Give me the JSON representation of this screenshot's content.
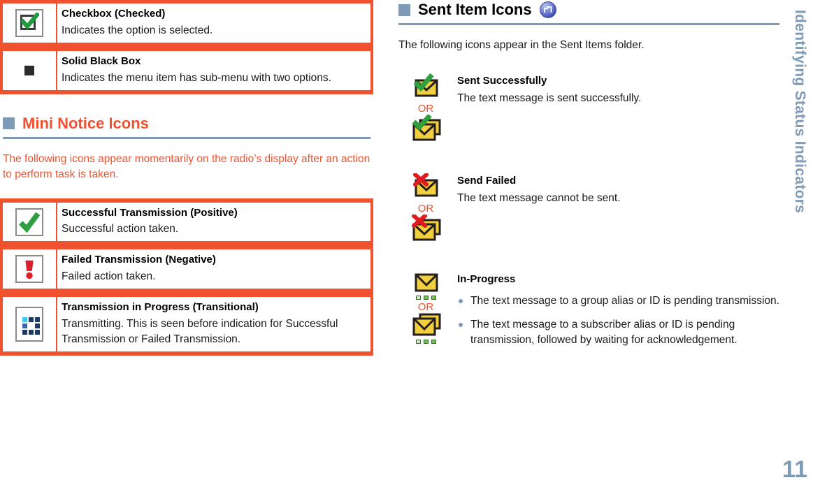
{
  "sidebar": {
    "chapter_label": "Identifying Status Indicators",
    "page_number": "11"
  },
  "colors": {
    "orange": "#f0522f",
    "blue_gray": "#7f9ab5",
    "heading_black": "#000000"
  },
  "left_column": {
    "top_table": {
      "rows": [
        {
          "icon": "checkbox-checked-icon",
          "title": "Checkbox (Checked)",
          "description": "Indicates the option is selected."
        },
        {
          "icon": "solid-black-box-icon",
          "title": "Solid Black Box",
          "description": "Indicates the menu item has sub-menu with two options."
        }
      ]
    },
    "section": {
      "bullet": "section-bullet-square",
      "title": "Mini Notice Icons",
      "lead": "The following icons appear momentarily on the radio’s display after an action to perform task is taken."
    },
    "bottom_table": {
      "rows": [
        {
          "icon": "green-check-icon",
          "title": "Successful Transmission (Positive)",
          "description": "Successful action taken."
        },
        {
          "icon": "red-exclamation-icon",
          "title": "Failed Transmission (Negative)",
          "description": "Failed action taken."
        },
        {
          "icon": "transmitting-grid-icon",
          "title": "Transmission in Progress (Transitional)",
          "description": "Transmitting. This is seen before indication for Successful Transmission or Failed Transmission."
        }
      ]
    }
  },
  "right_column": {
    "section": {
      "bullet": "section-bullet-square",
      "title": "Sent Item Icons",
      "badge": "step-wave-badge-icon",
      "lead": "The following icons appear in the Sent Items folder."
    },
    "rows": [
      {
        "icon_primary": "envelope-green-check-single-icon",
        "or_label": "OR",
        "icon_secondary": "envelope-green-check-stacked-icon",
        "title": "Sent Successfully",
        "description": "The text message is sent successfully.",
        "bullets": []
      },
      {
        "icon_primary": "envelope-red-x-single-icon",
        "or_label": "OR",
        "icon_secondary": "envelope-red-x-stacked-icon",
        "title": "Send Failed",
        "description": "The text message cannot be sent.",
        "bullets": []
      },
      {
        "icon_primary": "envelope-pending-single-icon",
        "or_label": "OR",
        "icon_secondary": "envelope-pending-stacked-icon",
        "title": "In-Progress",
        "description": "",
        "bullets": [
          "The text message to a group alias or ID is pending transmission.",
          "The text message to a subscriber alias or ID is pending transmission, followed by waiting for acknowledgement."
        ]
      }
    ]
  }
}
